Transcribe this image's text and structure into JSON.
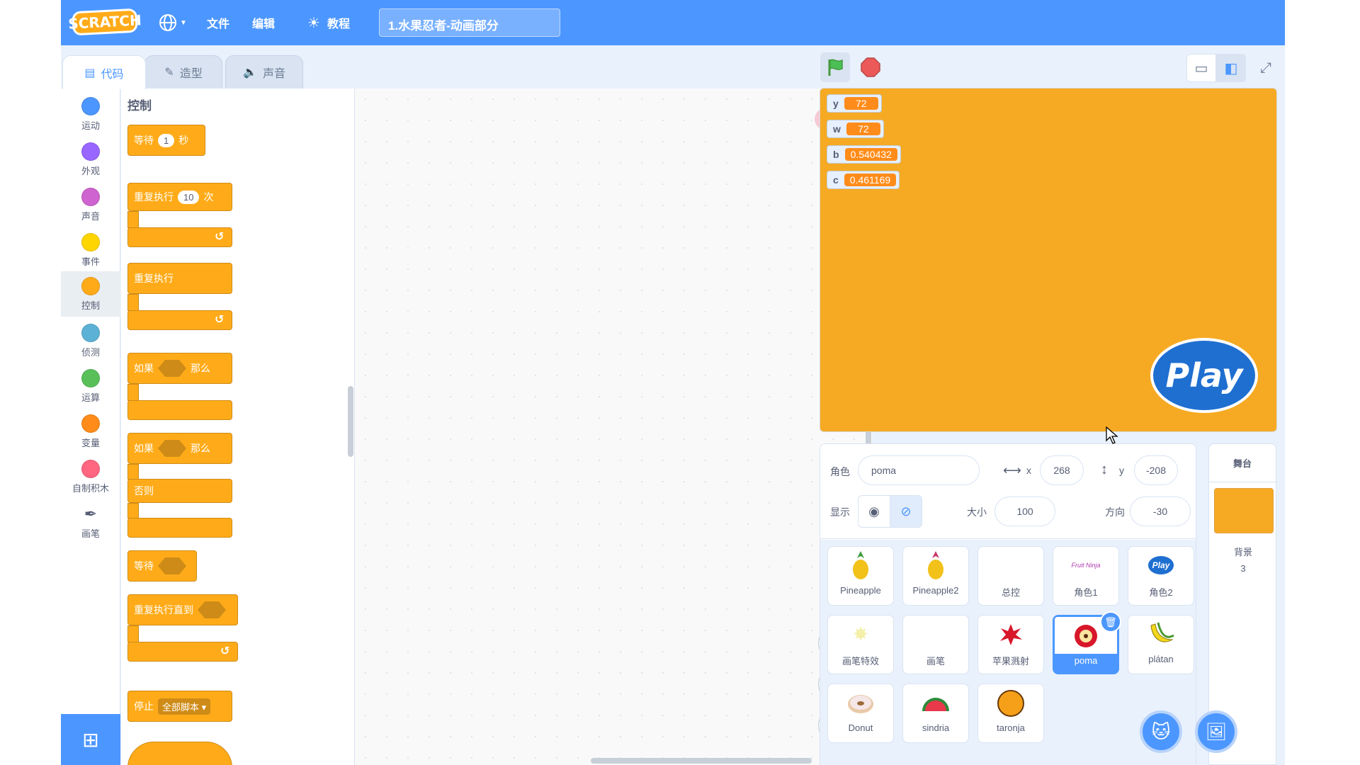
{
  "menubar": {
    "logo": "SCRATCH",
    "file": "文件",
    "edit": "编辑",
    "tutorials": "教程",
    "project_title": "1.水果忍者-动画部分"
  },
  "tabs": {
    "code": "代码",
    "costumes": "造型",
    "sounds": "声音"
  },
  "categories": [
    {
      "label": "运动",
      "color": "#4c97ff"
    },
    {
      "label": "外观",
      "color": "#9966ff"
    },
    {
      "label": "声音",
      "color": "#cf63cf"
    },
    {
      "label": "事件",
      "color": "#ffd500"
    },
    {
      "label": "控制",
      "color": "#ffab19"
    },
    {
      "label": "侦测",
      "color": "#5cb1d6"
    },
    {
      "label": "运算",
      "color": "#59c059"
    },
    {
      "label": "变量",
      "color": "#ff8c1a"
    },
    {
      "label": "自制积木",
      "color": "#ff6680"
    },
    {
      "label": "画笔",
      "color": "#0fbd8c"
    }
  ],
  "palette": {
    "title": "控制",
    "wait": "等待",
    "wait_value": "1",
    "seconds": "秒",
    "repeat": "重复执行",
    "repeat_value": "10",
    "times": "次",
    "forever": "重复执行",
    "if": "如果",
    "then": "那么",
    "if2": "如果",
    "then2": "那么",
    "else": "否则",
    "wait_until": "等待",
    "repeat_until": "重复执行直到",
    "stop": "停止",
    "stop_option": "全部脚本"
  },
  "monitors": [
    {
      "name": "y",
      "value": "72"
    },
    {
      "name": "w",
      "value": "72"
    },
    {
      "name": "b",
      "value": "0.540432"
    },
    {
      "name": "c",
      "value": "0.461169"
    }
  ],
  "stage_logo": "Play",
  "sprite_info": {
    "sprite_label": "角色",
    "sprite_name": "poma",
    "x_label": "x",
    "x": "268",
    "y_label": "y",
    "y": "-208",
    "show_label": "显示",
    "size_label": "大小",
    "size": "100",
    "direction_label": "方向",
    "direction": "-30"
  },
  "sprites": [
    {
      "name": "Pineapple"
    },
    {
      "name": "Pineapple2"
    },
    {
      "name": "总控"
    },
    {
      "name": "角色1"
    },
    {
      "name": "角色2"
    },
    {
      "name": "画笔特效"
    },
    {
      "name": "画笔"
    },
    {
      "name": "苹果溅射"
    },
    {
      "name": "poma"
    },
    {
      "name": "plátan"
    },
    {
      "name": "Donut"
    },
    {
      "name": "sindria"
    },
    {
      "name": "taronja"
    }
  ],
  "sprite_thumb_text": {
    "fruit_ninja": "Fruit Ninja",
    "play": "Play"
  },
  "stage_panel": {
    "title": "舞台",
    "backdrop_label": "背景",
    "backdrop_count": "3"
  },
  "colors": {
    "menubar": "#4c97ff",
    "control": "#ffab19",
    "stage_bg": "#f6aa23",
    "monitor_value": "#ff8c1a"
  }
}
